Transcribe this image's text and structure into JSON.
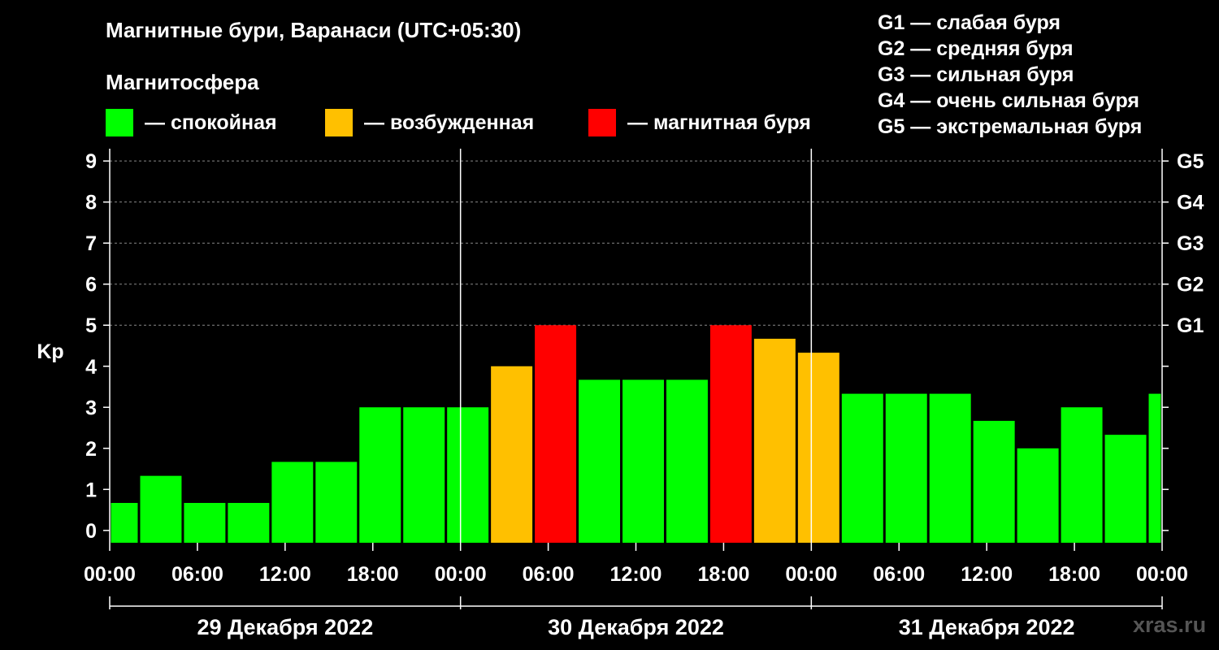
{
  "title": "Магнитные бури, Варанаси (UTC+05:30)",
  "subtitle": "Магнитосфера",
  "legend": [
    {
      "label": "— спокойная",
      "color": "#00ff00"
    },
    {
      "label": "— возбужденная",
      "color": "#ffc000"
    },
    {
      "label": "— магнитная буря",
      "color": "#ff0000"
    }
  ],
  "storm_scale": [
    "G1 — слабая буря",
    "G2 — средняя буря",
    "G3 — сильная буря",
    "G4 — очень сильная буря",
    "G5 — экстремальная буря"
  ],
  "watermark": "xras.ru",
  "chart_data": {
    "type": "bar",
    "ylabel": "Kp",
    "ylim": [
      -0.3,
      9.3
    ],
    "yticks": [
      0,
      1,
      2,
      3,
      4,
      5,
      6,
      7,
      8,
      9
    ],
    "right_ticks": [
      {
        "value": 5,
        "label": "G1"
      },
      {
        "value": 6,
        "label": "G2"
      },
      {
        "value": 7,
        "label": "G3"
      },
      {
        "value": 8,
        "label": "G4"
      },
      {
        "value": 9,
        "label": "G5"
      }
    ],
    "xticks": [
      "00:00",
      "06:00",
      "12:00",
      "18:00",
      "00:00",
      "06:00",
      "12:00",
      "18:00",
      "00:00",
      "06:00",
      "12:00",
      "18:00",
      "00:00"
    ],
    "days": [
      "29 Декабря 2022",
      "30 Декабря 2022",
      "31 Декабря 2022"
    ],
    "hours_total": 72,
    "bars": [
      {
        "start_hour": 0,
        "end_hour": 2,
        "value": 0.67,
        "status": "quiet"
      },
      {
        "start_hour": 2,
        "end_hour": 5,
        "value": 1.33,
        "status": "quiet"
      },
      {
        "start_hour": 5,
        "end_hour": 8,
        "value": 0.67,
        "status": "quiet"
      },
      {
        "start_hour": 8,
        "end_hour": 11,
        "value": 0.67,
        "status": "quiet"
      },
      {
        "start_hour": 11,
        "end_hour": 14,
        "value": 1.67,
        "status": "quiet"
      },
      {
        "start_hour": 14,
        "end_hour": 17,
        "value": 1.67,
        "status": "quiet"
      },
      {
        "start_hour": 17,
        "end_hour": 20,
        "value": 3.0,
        "status": "quiet"
      },
      {
        "start_hour": 20,
        "end_hour": 23,
        "value": 3.0,
        "status": "quiet"
      },
      {
        "start_hour": 23,
        "end_hour": 26,
        "value": 3.0,
        "status": "quiet"
      },
      {
        "start_hour": 26,
        "end_hour": 29,
        "value": 4.0,
        "status": "active"
      },
      {
        "start_hour": 29,
        "end_hour": 32,
        "value": 5.0,
        "status": "storm"
      },
      {
        "start_hour": 32,
        "end_hour": 35,
        "value": 3.67,
        "status": "quiet"
      },
      {
        "start_hour": 35,
        "end_hour": 38,
        "value": 3.67,
        "status": "quiet"
      },
      {
        "start_hour": 38,
        "end_hour": 41,
        "value": 3.67,
        "status": "quiet"
      },
      {
        "start_hour": 41,
        "end_hour": 44,
        "value": 5.0,
        "status": "storm"
      },
      {
        "start_hour": 44,
        "end_hour": 47,
        "value": 4.67,
        "status": "active"
      },
      {
        "start_hour": 47,
        "end_hour": 50,
        "value": 4.33,
        "status": "active"
      },
      {
        "start_hour": 50,
        "end_hour": 53,
        "value": 3.33,
        "status": "quiet"
      },
      {
        "start_hour": 53,
        "end_hour": 56,
        "value": 3.33,
        "status": "quiet"
      },
      {
        "start_hour": 56,
        "end_hour": 59,
        "value": 3.33,
        "status": "quiet"
      },
      {
        "start_hour": 59,
        "end_hour": 62,
        "value": 2.67,
        "status": "quiet"
      },
      {
        "start_hour": 62,
        "end_hour": 65,
        "value": 2.0,
        "status": "quiet"
      },
      {
        "start_hour": 65,
        "end_hour": 68,
        "value": 3.0,
        "status": "quiet"
      },
      {
        "start_hour": 68,
        "end_hour": 71,
        "value": 2.33,
        "status": "quiet"
      },
      {
        "start_hour": 71,
        "end_hour": 72,
        "value": 3.33,
        "status": "quiet"
      }
    ],
    "colors": {
      "quiet": "#00ff00",
      "active": "#ffc000",
      "storm": "#ff0000"
    }
  }
}
